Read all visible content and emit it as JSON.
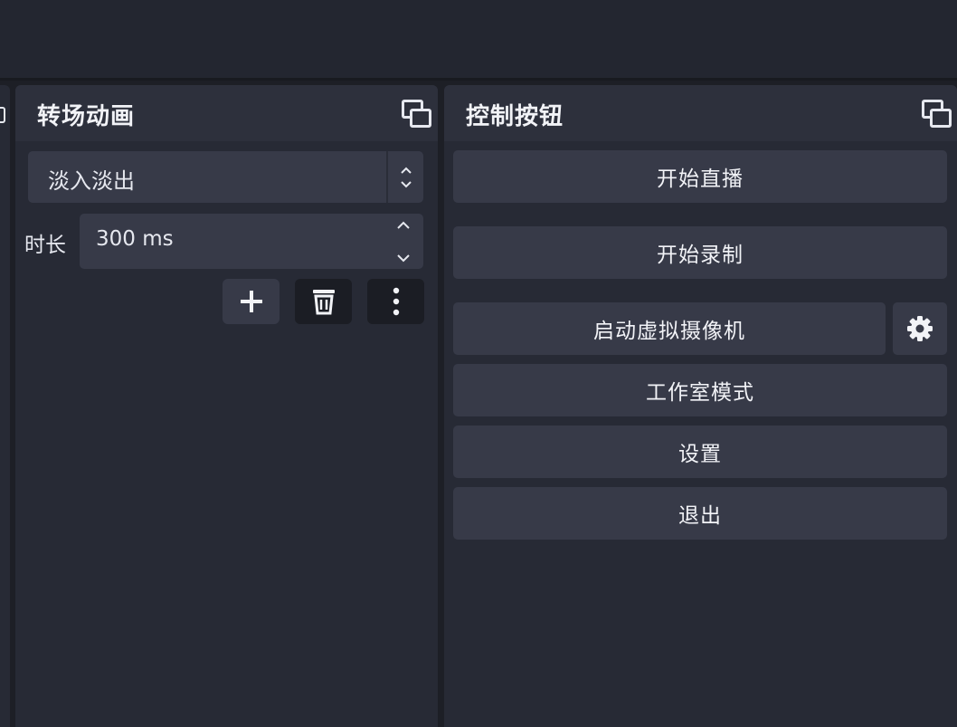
{
  "transitions_dock": {
    "title": "转场动画",
    "selected_transition": "淡入淡出",
    "duration_label": "时长",
    "duration_value": "300 ms"
  },
  "controls_dock": {
    "title": "控制按钮",
    "buttons": [
      {
        "label": "开始直播"
      },
      {
        "label": "开始录制"
      },
      {
        "label": "启动虚拟摄像机"
      },
      {
        "label": "工作室模式"
      },
      {
        "label": "设置"
      },
      {
        "label": "退出"
      }
    ]
  },
  "icons": {
    "float": "float-dock-icon",
    "add": "plus-icon",
    "remove": "trash-icon",
    "more": "more-vertical-icon",
    "vcam_settings": "gear-icon"
  },
  "colors": {
    "background": "#1d1f26",
    "dock": "#272a35",
    "dock_header": "#2d303c",
    "button": "#373a48",
    "text": "#e6e8ef"
  }
}
